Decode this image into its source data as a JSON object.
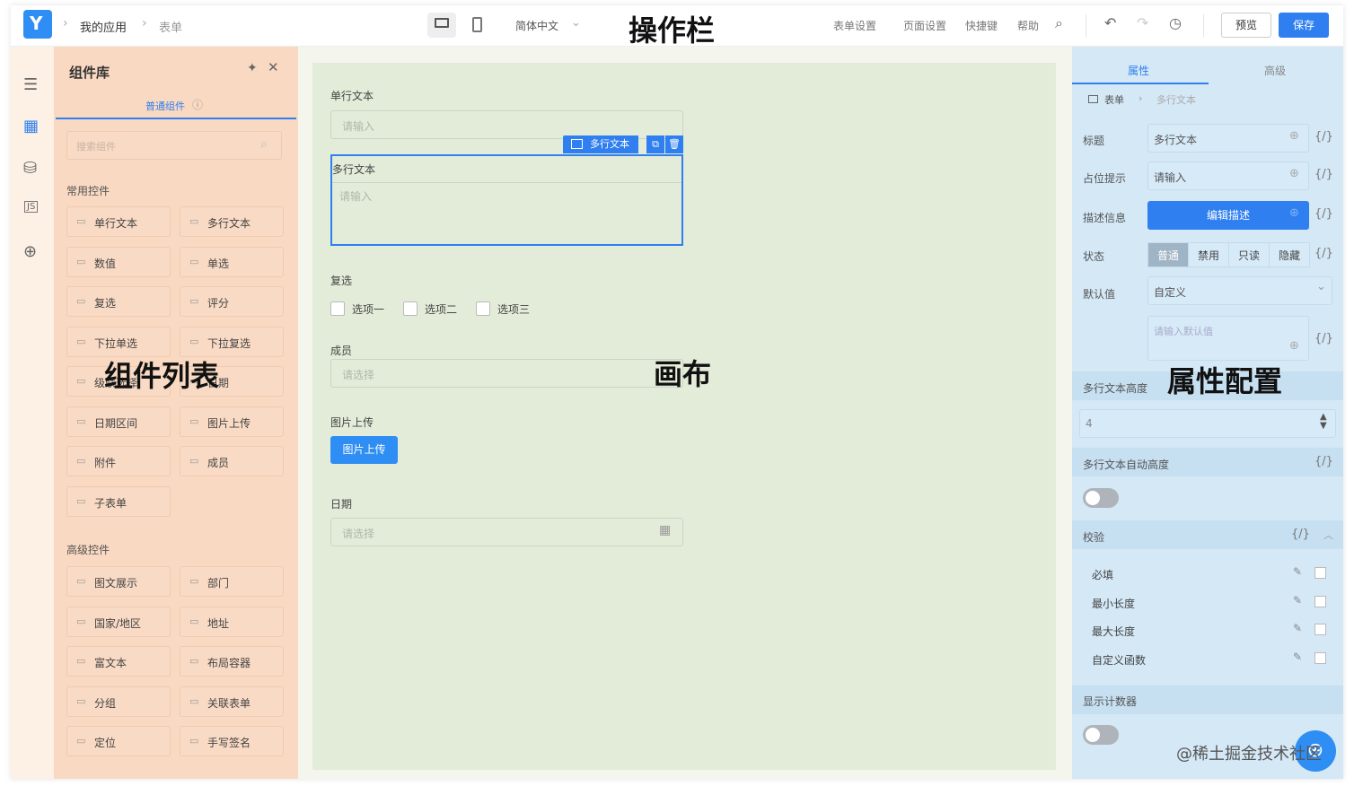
{
  "toolbar": {
    "breadcrumb_app": "我的应用",
    "breadcrumb_form": "表单",
    "language": "简体中文",
    "overlay_label": "操作栏",
    "menu_form_settings": "表单设置",
    "menu_page_settings": "页面设置",
    "menu_shortcuts": "快捷键",
    "menu_help": "帮助",
    "preview_label": "预览",
    "save_label": "保存"
  },
  "library": {
    "title": "组件库",
    "tab": "普通组件",
    "search_placeholder": "搜索组件",
    "section_common": "常用控件",
    "common_items": [
      "单行文本",
      "多行文本",
      "数值",
      "单选",
      "复选",
      "评分",
      "下拉单选",
      "下拉复选",
      "级联选择",
      "日期",
      "日期区间",
      "图片上传",
      "附件",
      "成员",
      "子表单"
    ],
    "section_advanced": "高级控件",
    "advanced_items": [
      "图文展示",
      "部门",
      "国家/地区",
      "地址",
      "富文本",
      "布局容器",
      "分组",
      "关联表单",
      "定位",
      "手写签名"
    ],
    "overlay_label": "组件列表"
  },
  "canvas": {
    "overlay_label": "画布",
    "single_text_label": "单行文本",
    "single_text_placeholder": "请输入",
    "multi_text_label": "多行文本",
    "multi_text_placeholder": "请输入",
    "selected_tag": "多行文本",
    "checkbox_label": "复选",
    "options": [
      "选项一",
      "选项二",
      "选项三"
    ],
    "member_label": "成员",
    "member_placeholder": "请选择",
    "image_upload_label": "图片上传",
    "image_upload_button": "图片上传",
    "date_label": "日期",
    "date_placeholder": "请选择"
  },
  "props": {
    "tab_props": "属性",
    "tab_advanced": "高级",
    "bc_form": "表单",
    "bc_field": "多行文本",
    "title_label": "标题",
    "title_value": "多行文本",
    "placeholder_label": "占位提示",
    "placeholder_value": "请输入",
    "desc_label": "描述信息",
    "desc_button": "编辑描述",
    "state_label": "状态",
    "states": [
      "普通",
      "禁用",
      "只读",
      "隐藏"
    ],
    "default_label": "默认值",
    "default_value": "自定义",
    "default_placeholder": "请输入默认值",
    "height_label": "多行文本高度",
    "height_value": "4",
    "auto_height_label": "多行文本自动高度",
    "validation_label": "校验",
    "validations": [
      "必填",
      "最小长度",
      "最大长度",
      "自定义函数"
    ],
    "counter_label": "显示计数器",
    "overlay_label": "属性配置",
    "fx": "{/}"
  },
  "watermark": "@稀土掘金技术社区"
}
